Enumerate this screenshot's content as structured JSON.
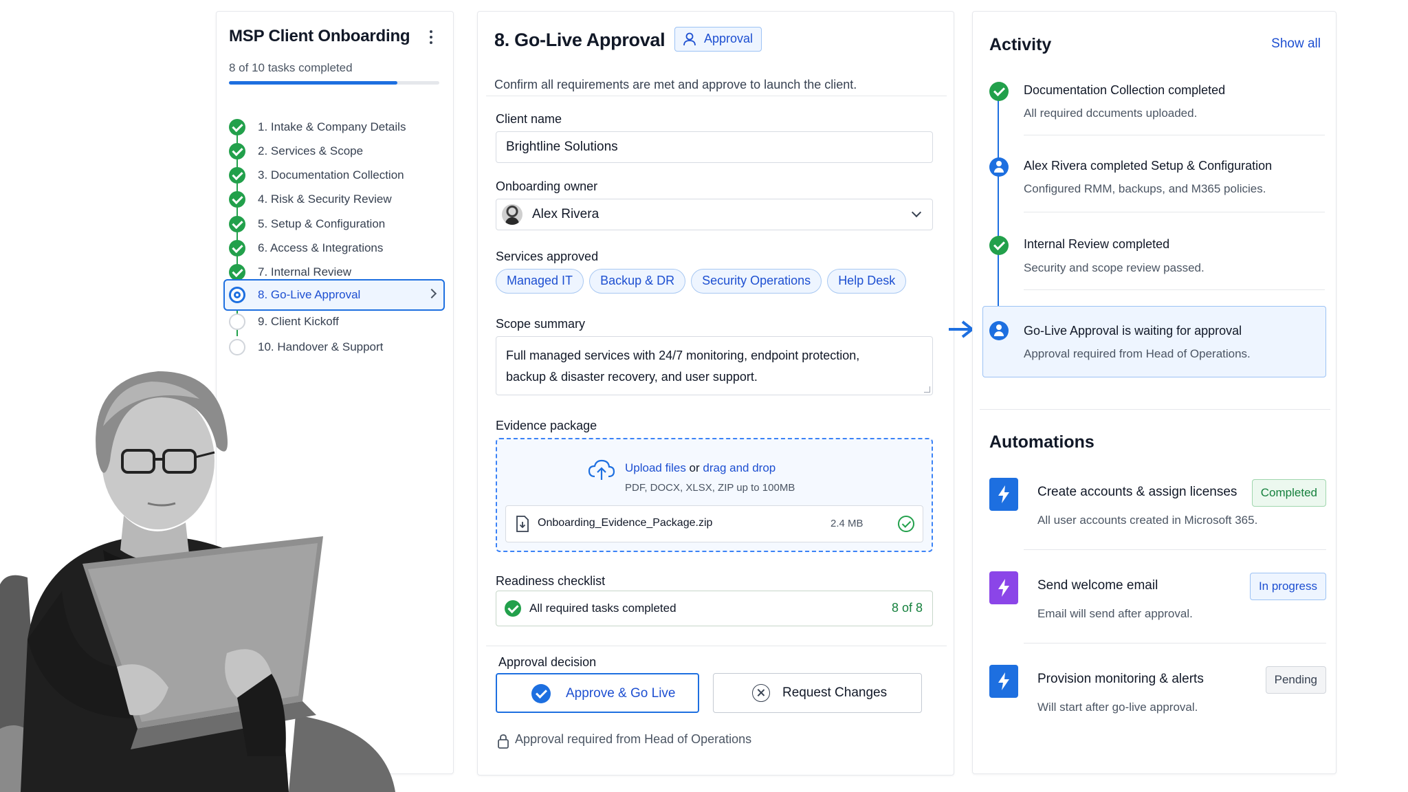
{
  "sidebar": {
    "title": "MSP Client Onboarding",
    "progress_text": "8 of 10 tasks completed",
    "progress_fraction": 0.8,
    "steps": [
      {
        "label": "1. Intake & Company Details",
        "status": "done"
      },
      {
        "label": "2. Services & Scope",
        "status": "done"
      },
      {
        "label": "3. Documentation Collection",
        "status": "done"
      },
      {
        "label": "4. Risk & Security Review",
        "status": "done"
      },
      {
        "label": "5. Setup & Configuration",
        "status": "done"
      },
      {
        "label": "6. Access & Integrations",
        "status": "done"
      },
      {
        "label": "7. Internal Review",
        "status": "done"
      },
      {
        "label": "8. Go-Live Approval",
        "status": "current"
      },
      {
        "label": "9. Client Kickoff",
        "status": "todo"
      },
      {
        "label": "10. Handover & Support",
        "status": "todo"
      }
    ]
  },
  "main": {
    "title": "8. Go-Live Approval",
    "badge": "Approval",
    "subtitle": "Confirm all requirements are met and approve to launch the client.",
    "client_name_label": "Client name",
    "client_name_value": "Brightline Solutions",
    "owner_label": "Onboarding owner",
    "owner_value": "Alex Rivera",
    "services_label": "Services approved",
    "services": [
      "Managed IT",
      "Backup & DR",
      "Security Operations",
      "Help Desk"
    ],
    "scope_label": "Scope summary",
    "scope_line1": "Full managed services with 24/7 monitoring, endpoint protection,",
    "scope_line2": "backup & disaster recovery, and user support.",
    "evidence_label": "Evidence package",
    "upload_link1": "Upload files",
    "upload_or": " or ",
    "upload_link2": "drag and drop",
    "upload_hint": "PDF, DOCX, XLSX, ZIP up to 100MB",
    "file_name": "Onboarding_Evidence_Package.zip",
    "file_size": "2.4 MB",
    "checklist_label": "Readiness checklist",
    "checklist_text": "All required tasks completed",
    "checklist_count": "8 of 8",
    "decision_label": "Approval decision",
    "approve_label": "Approve & Go Live",
    "changes_label": "Request Changes",
    "lock_note": "Approval required from Head of Operations"
  },
  "activity": {
    "title": "Activity",
    "show_all": "Show all",
    "items": [
      {
        "title": "Documentation Collection completed",
        "detail": "All required dccuments uploaded.",
        "icon": "check-icon"
      },
      {
        "title": "Alex Rivera completed Setup & Configuration",
        "detail": "Configured RMM, backups, and M365 policies.",
        "icon": "user-icon"
      },
      {
        "title": "Internal Review completed",
        "detail": "Security and scope review passed.",
        "icon": "check-icon"
      },
      {
        "title": "Go-Live Approval is waiting for approval",
        "detail": "Approval required from Head of Operations.",
        "icon": "user-icon"
      }
    ]
  },
  "automations": {
    "title": "Automations",
    "items": [
      {
        "title": "Create accounts & assign licenses",
        "detail": "All user accounts created in Microsoft 365.",
        "status": "Completed",
        "color": "#1d6fe0"
      },
      {
        "title": "Send welcome email",
        "detail": "Email will send after approval.",
        "status": "In progress",
        "color": "#8b45e8"
      },
      {
        "title": "Provision monitoring & alerts",
        "detail": "Will start after go-live approval.",
        "status": "Pending",
        "color": "#1d6fe0"
      }
    ]
  },
  "colors": {
    "accent": "#1d6fe0",
    "success": "#22a04b",
    "purple": "#8b45e8"
  }
}
